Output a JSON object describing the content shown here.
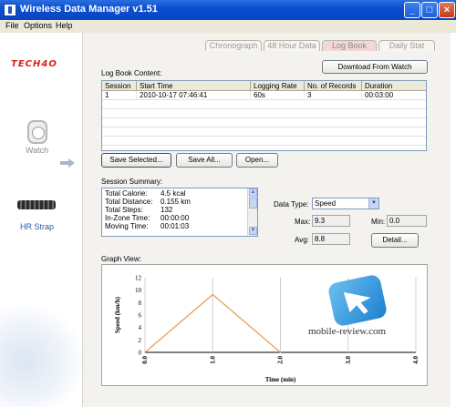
{
  "window": {
    "title": "Wireless Data Manager v1.51",
    "min": "_",
    "max": "□",
    "close": "×"
  },
  "menu": [
    "File",
    "Options",
    "Help"
  ],
  "sidebar": {
    "brand": "TECH4O",
    "watch_label": "Watch",
    "strap_label": "HR Strap"
  },
  "tabs": [
    "Chronograph",
    "48 Hour Data",
    "Log Book",
    "Daily Stat"
  ],
  "active_tab": "Log Book",
  "logbook": {
    "label": "Log Book Content:",
    "download_button": "Download From Watch",
    "columns": [
      "Session",
      "Start Time",
      "Logging Rate",
      "No. of Records",
      "Duration"
    ],
    "rows": [
      [
        "1",
        "2010-10-17 07:46:41",
        "60s",
        "3",
        "00:03:00"
      ]
    ],
    "save_selected": "Save Selected...",
    "save_all": "Save All...",
    "open": "Open..."
  },
  "summary": {
    "label": "Session Summary:",
    "items": [
      {
        "k": "Total Calorie:",
        "v": "4.5 kcal"
      },
      {
        "k": "Total Distance:",
        "v": "0.155 km"
      },
      {
        "k": "Total Steps:",
        "v": "132"
      },
      {
        "k": "In-Zone Time:",
        "v": "00:00:00"
      },
      {
        "k": "Moving Time:",
        "v": "00:01:03"
      }
    ]
  },
  "datatype": {
    "label": "Data Type:",
    "value": "Speed",
    "max_label": "Max:",
    "max": "9.3",
    "min_label": "Min:",
    "min": "0.0",
    "avg_label": "Avg:",
    "avg": "8.8",
    "detail": "Detail..."
  },
  "graph": {
    "label": "Graph View:"
  },
  "watermark": "mobile-review.com",
  "chart_data": {
    "type": "line",
    "title": "",
    "xlabel": "Time (min)",
    "ylabel": "Speed (km/h)",
    "x": [
      0,
      1,
      2
    ],
    "series": [
      {
        "values": [
          0,
          9.3,
          0
        ],
        "color": "#e0a35a"
      }
    ],
    "xticks": [
      "0.0",
      "1.0",
      "2.0",
      "3.0",
      "4.0"
    ],
    "yticks": [
      "0",
      "2",
      "4",
      "6",
      "8",
      "10",
      "12"
    ],
    "xlim": [
      0,
      4
    ],
    "ylim": [
      0,
      12
    ],
    "grid": "vertical"
  }
}
